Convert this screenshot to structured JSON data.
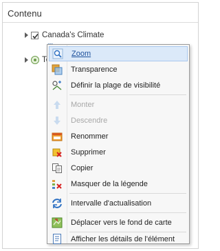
{
  "panel": {
    "title": "Contenu"
  },
  "layers": [
    {
      "label": "Canada's Climate",
      "checked": true
    },
    {
      "label": "To",
      "checked": false
    }
  ],
  "context_menu": {
    "items": [
      {
        "label": "Zoom",
        "icon": "zoom-icon",
        "state": "hover"
      },
      {
        "label": "Transparence",
        "icon": "transparency-icon",
        "state": "enabled"
      },
      {
        "label": "Définir la plage de visibilité",
        "icon": "visibility-range-icon",
        "state": "enabled"
      },
      {
        "label": "Monter",
        "icon": "arrow-up-icon",
        "state": "disabled"
      },
      {
        "label": "Descendre",
        "icon": "arrow-down-icon",
        "state": "disabled"
      },
      {
        "label": "Renommer",
        "icon": "rename-icon",
        "state": "enabled"
      },
      {
        "label": "Supprimer",
        "icon": "delete-icon",
        "state": "enabled"
      },
      {
        "label": "Copier",
        "icon": "copy-icon",
        "state": "enabled"
      },
      {
        "label": "Masquer de la légende",
        "icon": "hide-legend-icon",
        "state": "enabled"
      },
      {
        "label": "Intervalle d'actualisation",
        "icon": "refresh-icon",
        "state": "enabled"
      },
      {
        "label": "Déplacer vers le fond de carte",
        "icon": "move-to-basemap-icon",
        "state": "enabled"
      },
      {
        "label": "Afficher les détails de l'élément",
        "icon": "item-details-icon",
        "state": "enabled"
      }
    ]
  }
}
